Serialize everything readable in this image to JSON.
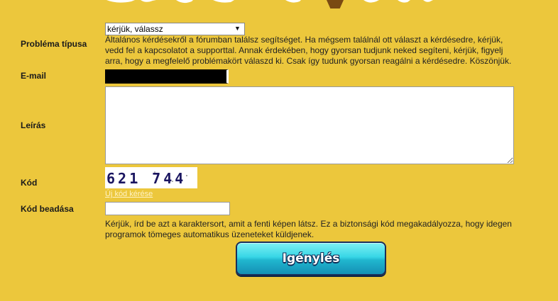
{
  "form": {
    "problem_type": {
      "label": "Probléma típusa",
      "selected": "kérjük, válassz",
      "help": "Általános kérdésekről a fórumban találsz segítséget. Ha mégsem találnál ott választ a kérdésedre, kérjük, vedd fel a kapcsolatot a supporttal. Annak érdekében, hogy gyorsan tudjunk neked segíteni, kérjük, figyelj arra, hogy a megfelelő problémakört válaszd ki. Csak így tudunk gyorsan reagálni a kérdésedre. Köszönjük."
    },
    "email": {
      "label": "E-mail"
    },
    "description": {
      "label": "Leírás"
    },
    "code": {
      "label": "Kód",
      "captcha_text": "621 744",
      "new_code_link": "Új kód kérése"
    },
    "code_entry": {
      "label": "Kód beadása",
      "help": "Kérjük, írd be azt a karaktersort, amit a fenti képen látsz. Ez a biztonsági kód megakadályozza, hogy idegen programok tömeges automatikus üzeneteket küldjenek."
    },
    "submit_label": "Igénylés"
  }
}
